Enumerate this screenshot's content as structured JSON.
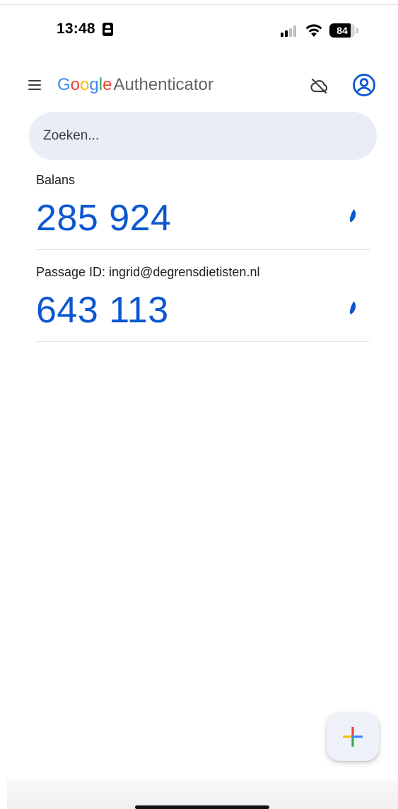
{
  "status_bar": {
    "time": "13:48",
    "battery_level": "84",
    "battery_fraction": 0.84
  },
  "app_bar": {
    "brand_letters": [
      {
        "char": "G",
        "color": "#4285f4"
      },
      {
        "char": "o",
        "color": "#ea4335"
      },
      {
        "char": "o",
        "color": "#fbbc04"
      },
      {
        "char": "g",
        "color": "#4285f4"
      },
      {
        "char": "l",
        "color": "#34a853"
      },
      {
        "char": "e",
        "color": "#ea4335"
      }
    ],
    "app_name": "Authenticator",
    "icons": {
      "menu": "menu-icon",
      "cloud": "cloud-off-icon",
      "account": "account-circle-icon"
    }
  },
  "search": {
    "placeholder": "Zoeken...",
    "value": ""
  },
  "accounts": [
    {
      "name": "Balans",
      "code": "285 924"
    },
    {
      "name": "Passage ID: ingrid@degrensdietisten.nl",
      "code": "643 113"
    }
  ],
  "fab": {
    "icon": "add-icon",
    "colors": [
      "#ea4335",
      "#4285f4",
      "#fbbc04",
      "#34a853"
    ]
  },
  "colors": {
    "accent": "#0b57d0",
    "search_bg": "#e9eef6"
  }
}
